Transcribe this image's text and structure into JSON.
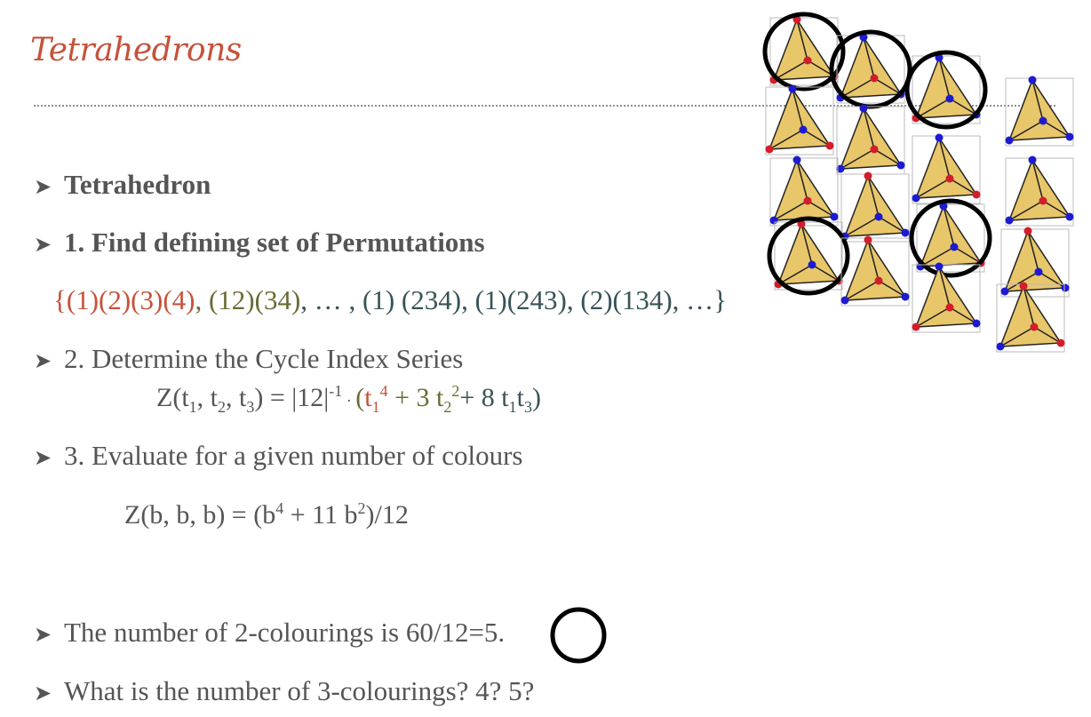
{
  "slide": {
    "title": "Tetrahedrons"
  },
  "bullets": {
    "b1": "Tetrahedron",
    "b2": "1. Find defining set of Permutations",
    "b3": "2. Determine the Cycle Index Series",
    "b4": "3. Evaluate for a given number of colours",
    "b5": "The number of 2-colourings is 60/12=5.",
    "b6": "What is the number of 3-colourings? 4? 5?"
  },
  "permutations": {
    "open": "{",
    "identity": "(1)(2)(3)(4)",
    "sep1": ", ",
    "double_transposition": "(12)(34)",
    "ellipsis1": ", … , ",
    "three_cycles": "(1) (234), (1)(243), (2)(134)",
    "ellipsis2": ", …}"
  },
  "cycle_index": {
    "lhs": "Z(t",
    "lhs_sub1": "1",
    "lhs_mid1": ", t",
    "lhs_sub2": "2",
    "lhs_mid2": ", t",
    "lhs_sub3": "3",
    "lhs_end": ")  =  |12|",
    "exp_neg1": "-1",
    "dot": " · ",
    "paren_open": "(",
    "t1_term": "t",
    "t1_sub": "1",
    "t1_sup": "4",
    "term2": " + 3 t",
    "term2_sub": "2",
    "term2_sup": "2",
    "term3": "+ 8 t",
    "term3_sub1": "1",
    "term3_mid": "t",
    "term3_sub2": "3",
    "paren_close": ")"
  },
  "evaluated": {
    "lhs": "Z(b, b, b)  =  (b",
    "sup1": "4",
    "mid": " + 11 b",
    "sup2": "2",
    "rhs": ")/12"
  },
  "colors": {
    "title": "#c5523b",
    "text": "#555555",
    "red_term": "#c5523b",
    "olive_term": "#6b6a33",
    "teal_term": "#375356",
    "tetra_face": "#e8c66a",
    "vertex_red": "#d21d2b",
    "vertex_blue": "#1d1ad0"
  }
}
